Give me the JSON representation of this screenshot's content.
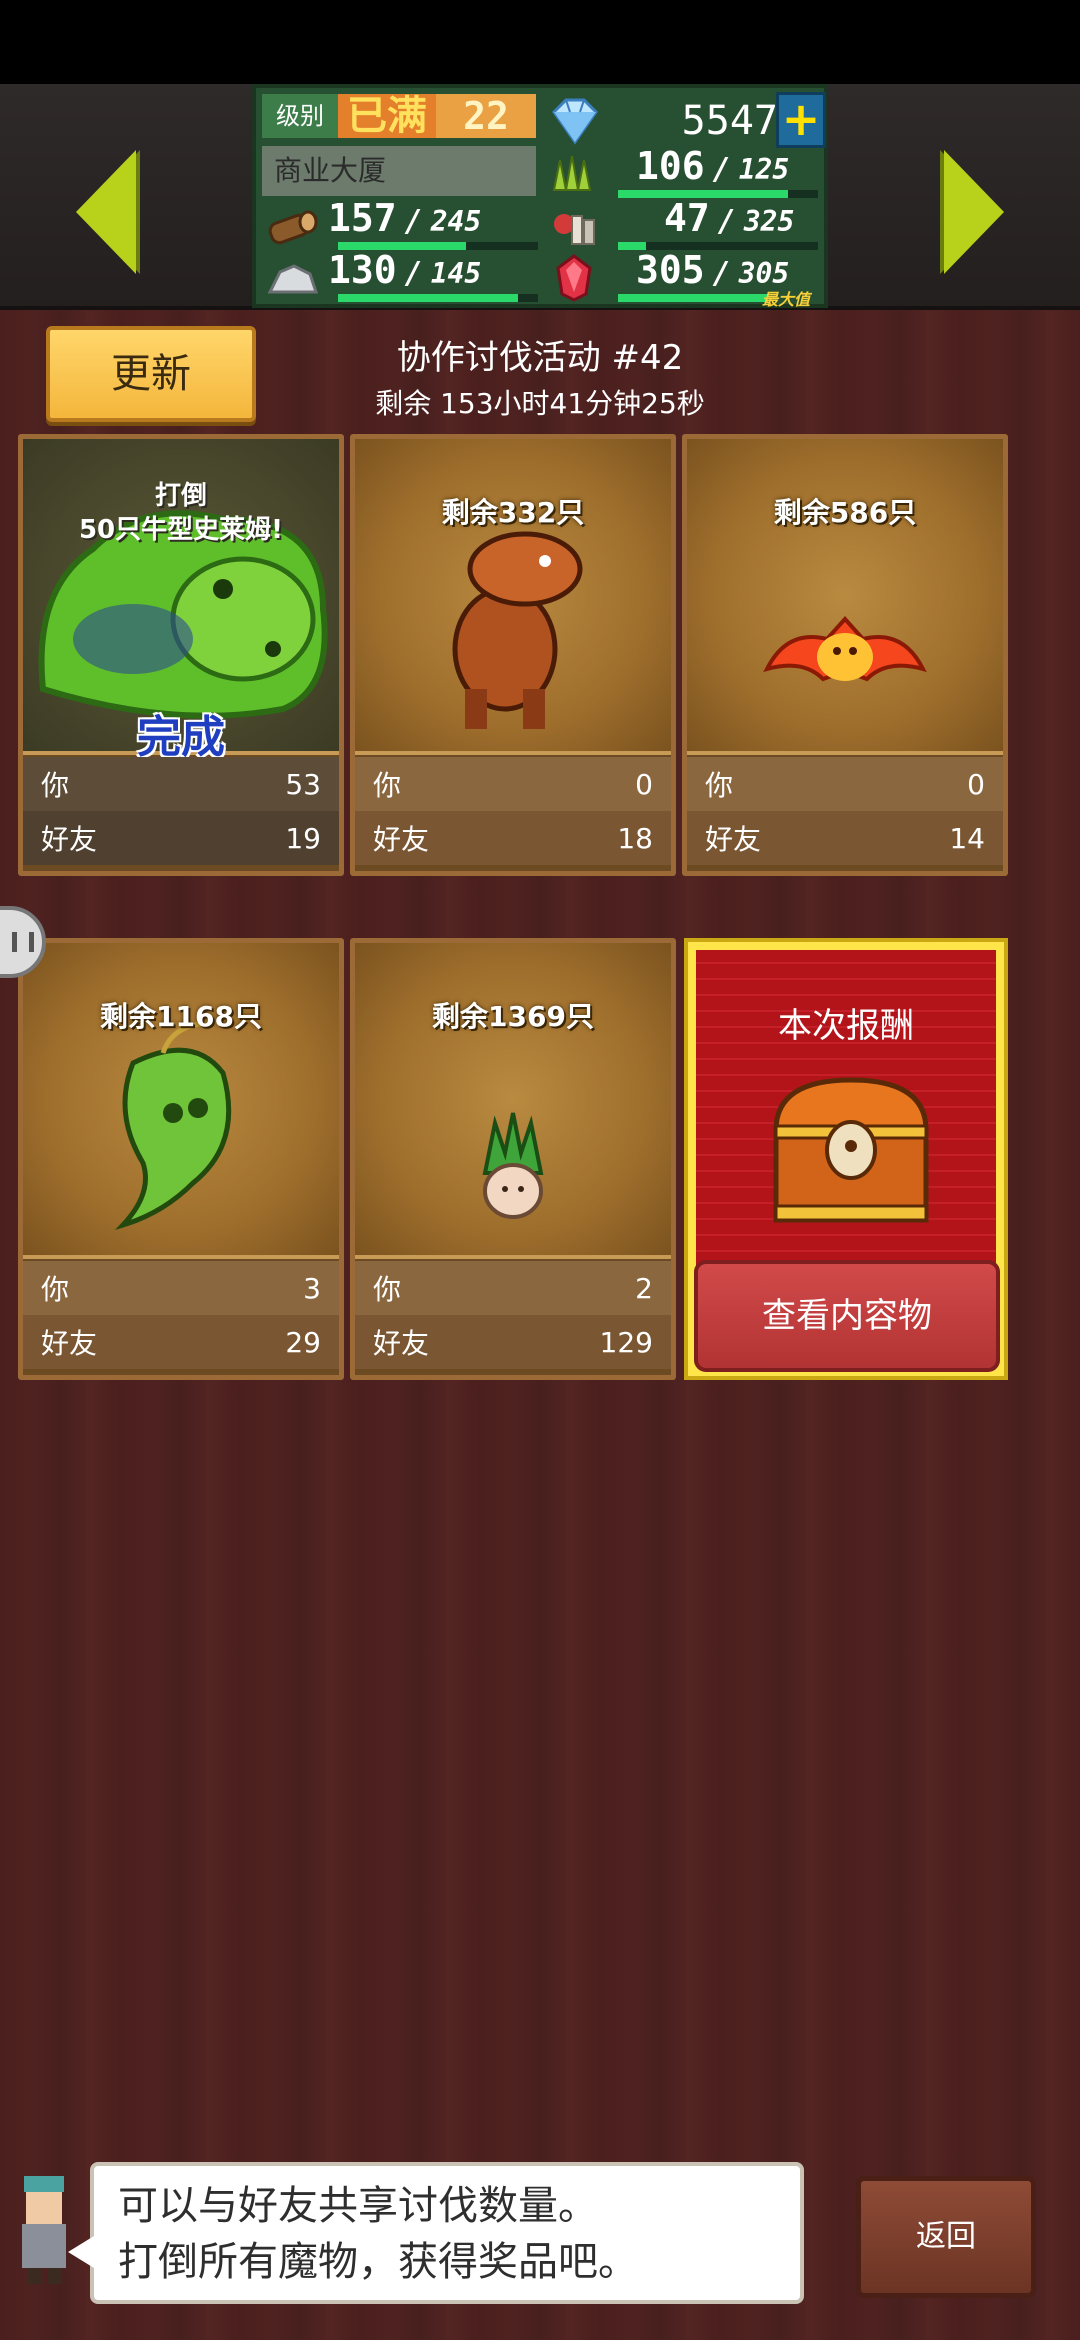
{
  "header": {
    "level_label": "级别",
    "level_max": "已满",
    "level": "22",
    "building": "商业大厦",
    "gems": "5547",
    "plus_label": "+",
    "resources": [
      {
        "name": "wood",
        "cur": "157",
        "max": "245",
        "fill": 0.64
      },
      {
        "name": "stone",
        "cur": "130",
        "max": "145",
        "fill": 0.9
      },
      {
        "name": "grass",
        "cur": "106",
        "max": "125",
        "fill": 0.85
      },
      {
        "name": "food",
        "cur": "47",
        "max": "325",
        "fill": 0.14
      },
      {
        "name": "ruby",
        "cur": "305",
        "max": "305",
        "fill": 1.0,
        "tag": "最大值"
      }
    ]
  },
  "event": {
    "refresh_label": "更新",
    "title": "协作讨伐活动 #42",
    "remaining": "剩余 153小时41分钟25秒"
  },
  "labels": {
    "you": "你",
    "friend": "好友"
  },
  "cards": [
    {
      "defeat_line1": "打倒",
      "defeat_line2": "50只牛型史莱姆!",
      "complete": "完成",
      "you": "53",
      "friend": "19",
      "monster": "slime-icon"
    },
    {
      "remaining": "剩余332只",
      "you": "0",
      "friend": "18",
      "monster": "dragon-icon"
    },
    {
      "remaining": "剩余586只",
      "you": "0",
      "friend": "14",
      "monster": "bat-icon"
    },
    {
      "remaining": "剩余1168只",
      "you": "3",
      "friend": "29",
      "monster": "leaf-ghost-icon"
    },
    {
      "remaining": "剩余1369只",
      "you": "2",
      "friend": "129",
      "monster": "mandrake-icon"
    }
  ],
  "reward": {
    "title": "本次报酬",
    "view_label": "查看内容物"
  },
  "dialog": {
    "line1": "可以与好友共享讨伐数量。",
    "line2": "打倒所有魔物，获得奖品吧。"
  },
  "return_label": "返回",
  "colors": {
    "bar": "#2bd86a",
    "reward_red": "#b3141a",
    "gold": "#ffe54a"
  }
}
